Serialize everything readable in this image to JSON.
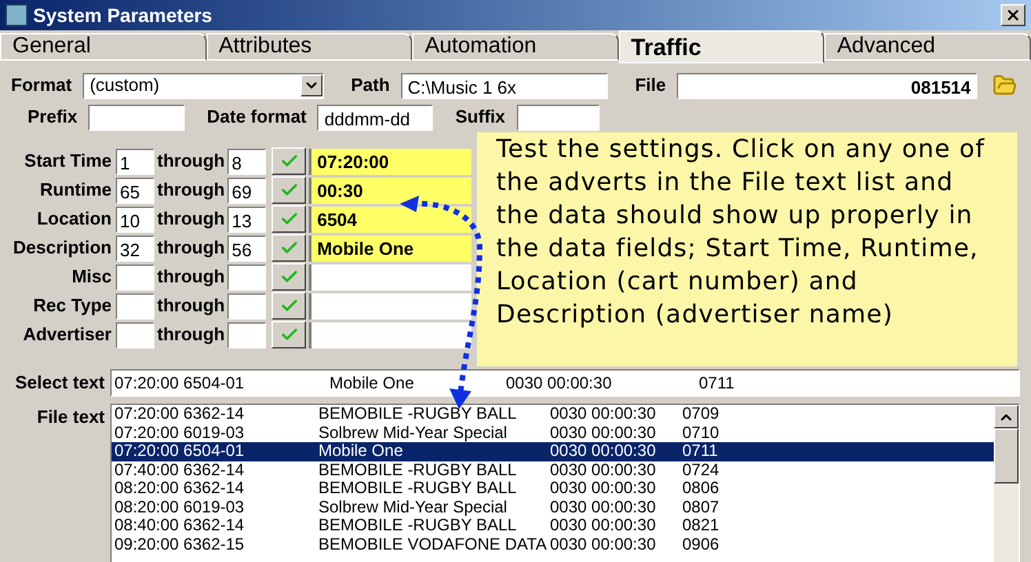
{
  "window": {
    "title": "System Parameters"
  },
  "tabs": [
    {
      "label": "General",
      "selected": false
    },
    {
      "label": "Attributes",
      "selected": false
    },
    {
      "label": "Automation",
      "selected": false
    },
    {
      "label": "Traffic",
      "selected": true
    },
    {
      "label": "Advanced",
      "selected": false
    }
  ],
  "format": {
    "label": "Format",
    "value": "(custom)"
  },
  "path": {
    "label": "Path",
    "value": "C:\\Music 1 6x"
  },
  "file": {
    "label": "File",
    "value": "081514"
  },
  "prefix": {
    "label": "Prefix"
  },
  "date_format": {
    "label": "Date format",
    "value": "dddmm-dd"
  },
  "suffix": {
    "label": "Suffix"
  },
  "fields": [
    {
      "label": "Start Time",
      "from": "1",
      "to": "8",
      "through": "through",
      "value": "07:20:00",
      "highlighted": true
    },
    {
      "label": "Runtime",
      "from": "65",
      "to": "69",
      "through": "through",
      "value": "00:30",
      "highlighted": true
    },
    {
      "label": "Location",
      "from": "10",
      "to": "13",
      "through": "through",
      "value": "6504",
      "highlighted": true
    },
    {
      "label": "Description",
      "from": "32",
      "to": "56",
      "through": "through",
      "value": "Mobile One",
      "highlighted": true
    },
    {
      "label": "Misc",
      "through": "through",
      "highlighted": false
    },
    {
      "label": "Rec Type",
      "through": "through",
      "highlighted": false
    },
    {
      "label": "Advertiser",
      "through": "through",
      "highlighted": false
    }
  ],
  "select_text": {
    "label": "Select text",
    "cells": [
      "07:20:00 6504-01",
      "Mobile One",
      "0030 00:00:30",
      "0711"
    ]
  },
  "file_text": {
    "label": "File text",
    "rows": [
      {
        "cells": [
          "07:20:00 6362-14",
          "BEMOBILE -RUGBY BALL",
          "0030 00:00:30",
          "0709"
        ],
        "selected": false
      },
      {
        "cells": [
          "07:20:00 6019-03",
          "Solbrew Mid-Year Special",
          "0030 00:00:30",
          "0710"
        ],
        "selected": false
      },
      {
        "cells": [
          "07:20:00 6504-01",
          "Mobile One",
          "0030 00:00:30",
          "0711"
        ],
        "selected": true
      },
      {
        "cells": [
          "07:40:00 6362-14",
          "BEMOBILE -RUGBY BALL",
          "0030 00:00:30",
          "0724"
        ],
        "selected": false
      },
      {
        "cells": [
          "08:20:00 6362-14",
          "BEMOBILE -RUGBY BALL",
          "0030 00:00:30",
          "0806"
        ],
        "selected": false
      },
      {
        "cells": [
          "08:20:00 6019-03",
          "Solbrew Mid-Year Special",
          "0030 00:00:30",
          "0807"
        ],
        "selected": false
      },
      {
        "cells": [
          "08:40:00 6362-14",
          "BEMOBILE -RUGBY BALL",
          "0030 00:00:30",
          "0821"
        ],
        "selected": false
      },
      {
        "cells": [
          "09:20:00 6362-15",
          "BEMOBILE VODAFONE DATA",
          "0030 00:00:30",
          "0906"
        ],
        "selected": false
      }
    ]
  },
  "callout": {
    "text": "Test the settings.  Click on any one of the adverts in the File text list and the data should show up properly in the data fields; Start Time, Runtime, Location (cart number) and Description (advertiser name)"
  }
}
